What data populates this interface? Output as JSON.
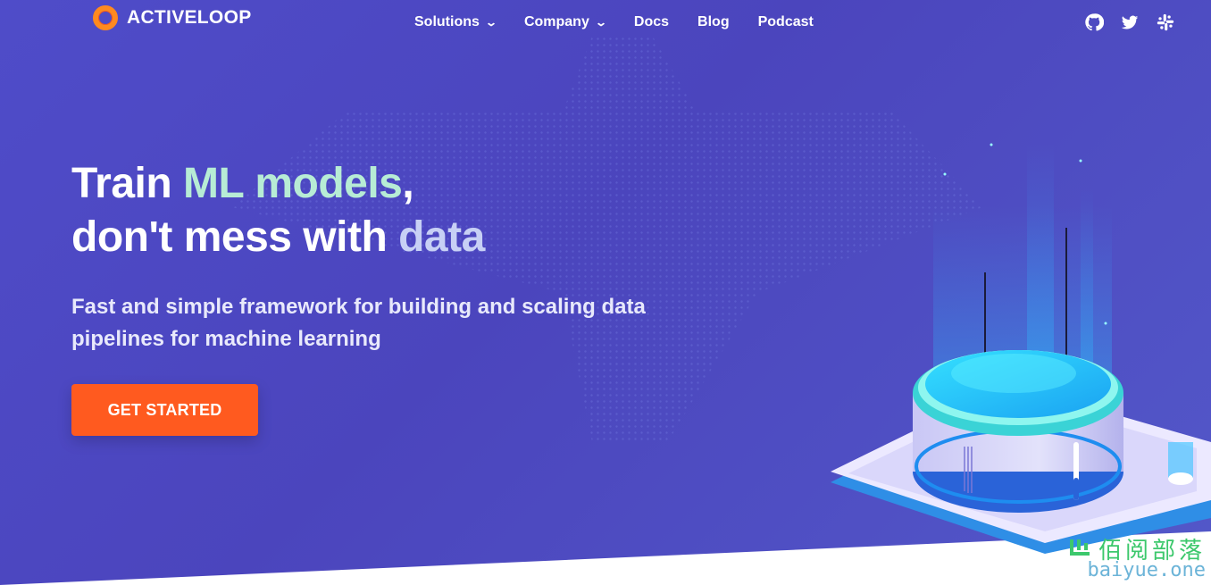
{
  "nav": {
    "brand": "ACTIVELOOP",
    "items": [
      {
        "label": "Solutions",
        "dropdown": true
      },
      {
        "label": "Company",
        "dropdown": true
      },
      {
        "label": "Docs",
        "dropdown": false
      },
      {
        "label": "Blog",
        "dropdown": false
      },
      {
        "label": "Podcast",
        "dropdown": false
      }
    ],
    "socials": [
      "github-icon",
      "twitter-icon",
      "slack-icon"
    ]
  },
  "hero": {
    "headline_1a": "Train ",
    "headline_1b": "ML models",
    "headline_1c": ",",
    "headline_2a": "don't mess with ",
    "headline_2b": "data",
    "subtitle_1": "Fast and simple framework for building and scaling data",
    "subtitle_2": "pipelines for machine learning",
    "cta": "GET STARTED"
  },
  "watermark": {
    "cn": "佰阅部落",
    "en": "baiyue.one"
  },
  "colors": {
    "background": "#4f4cc9",
    "accent": "#ff5a1f",
    "headline_green": "#b7ecd5",
    "headline_lavender": "#c7d0f5"
  }
}
